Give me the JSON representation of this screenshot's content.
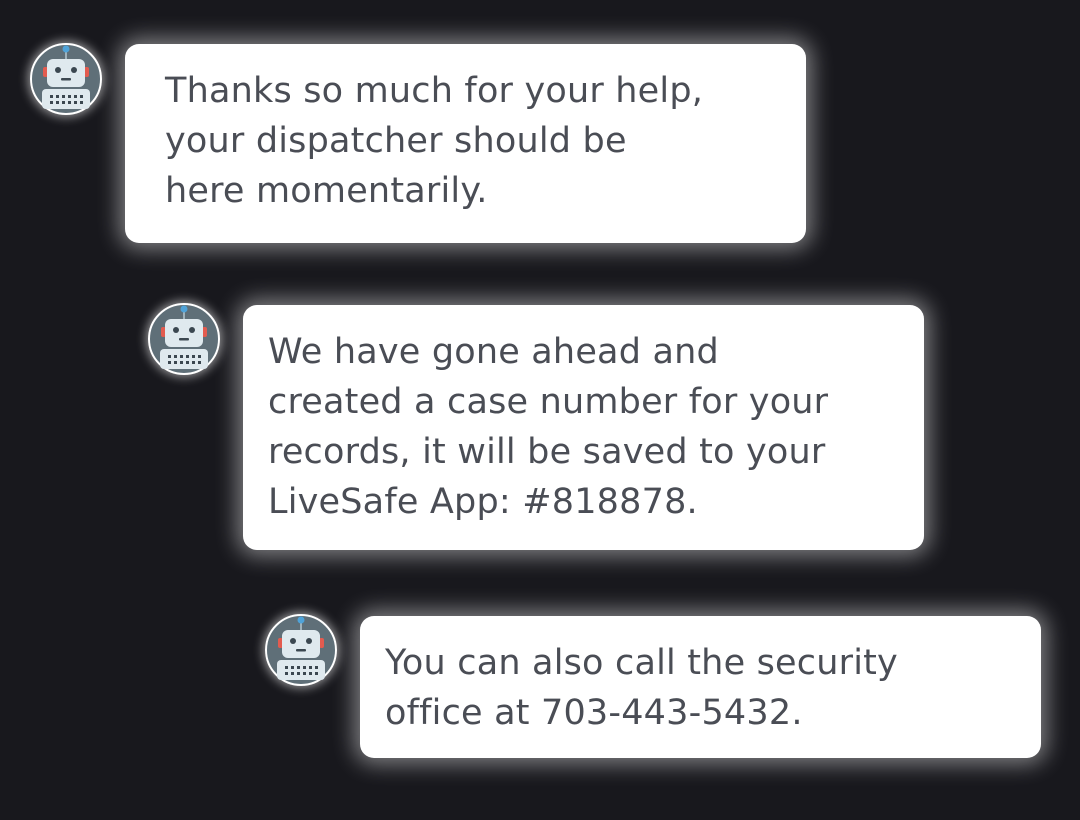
{
  "messages": [
    {
      "sender_icon": "robot-icon",
      "lines": [
        "Thanks so much for your help,",
        "your dispatcher should be",
        "here momentarily."
      ]
    },
    {
      "sender_icon": "robot-icon",
      "lines": [
        "We have gone ahead and",
        "created a case number for your",
        "records, it will be saved to your",
        "LiveSafe App: #818878."
      ]
    },
    {
      "sender_icon": "robot-icon",
      "lines": [
        "You can also call the security",
        "office at 703-443-5432."
      ]
    }
  ],
  "colors": {
    "background": "#18181d",
    "bubble": "#ffffff",
    "text": "#4a4d55",
    "avatar_bg": "#5f6f78",
    "robot_body": "#dfe9ee",
    "robot_accent": "#4fa3d9",
    "robot_ear": "#e35b4f"
  }
}
